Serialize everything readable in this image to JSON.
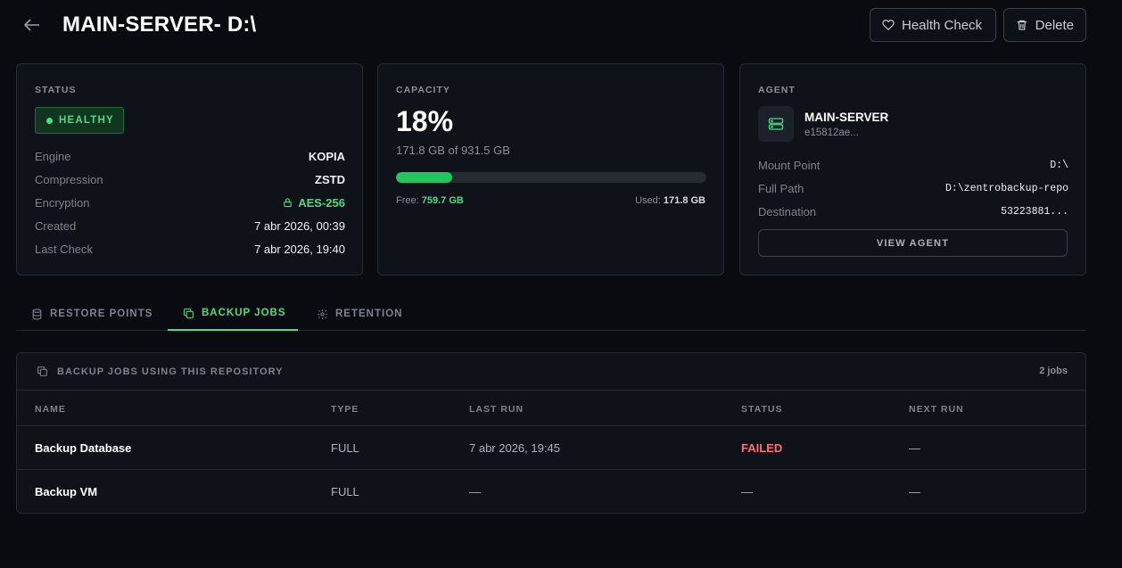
{
  "header": {
    "title": "MAIN-SERVER- D:\\",
    "health_check_label": "Health Check",
    "delete_label": "Delete"
  },
  "status_card": {
    "label": "STATUS",
    "badge": "HEALTHY",
    "rows": [
      {
        "key": "Engine",
        "value": "KOPIA"
      },
      {
        "key": "Compression",
        "value": "ZSTD"
      },
      {
        "key": "Encryption",
        "value": "AES-256"
      },
      {
        "key": "Created",
        "value": "7 abr 2026, 00:39"
      },
      {
        "key": "Last Check",
        "value": "7 abr 2026, 19:40"
      }
    ]
  },
  "capacity_card": {
    "label": "CAPACITY",
    "percent": "18%",
    "used_of_total": "171.8 GB of 931.5 GB",
    "used_fraction": 0.18,
    "free_label": "Free:",
    "free_value": "759.7 GB",
    "used_label": "Used:",
    "used_value": "171.8 GB"
  },
  "agent_card": {
    "label": "AGENT",
    "name": "MAIN-SERVER",
    "id": "e15812ae...",
    "rows": [
      {
        "key": "Mount Point",
        "value": "D:\\"
      },
      {
        "key": "Full Path",
        "value": "D:\\zentrobackup-repo"
      },
      {
        "key": "Destination",
        "value": "53223881..."
      }
    ],
    "view_agent_label": "VIEW AGENT"
  },
  "tabs": [
    {
      "label": "RESTORE POINTS",
      "icon": "database-icon",
      "active": false
    },
    {
      "label": "BACKUP JOBS",
      "icon": "copy-icon",
      "active": true
    },
    {
      "label": "RETENTION",
      "icon": "gear-icon",
      "active": false
    }
  ],
  "jobs": {
    "title": "BACKUP JOBS USING THIS REPOSITORY",
    "count": "2 jobs",
    "columns": [
      "NAME",
      "TYPE",
      "LAST RUN",
      "STATUS",
      "NEXT RUN"
    ],
    "rows": [
      {
        "name": "Backup Database",
        "type": "FULL",
        "last_run": "7 abr 2026, 19:45",
        "status": "FAILED",
        "next_run": "—"
      },
      {
        "name": "Backup VM",
        "type": "FULL",
        "last_run": "—",
        "status": "—",
        "next_run": "—"
      }
    ]
  },
  "colors": {
    "accent": "#4ade80",
    "failed": "#f87171",
    "background": "#090b11",
    "card": "#0f1218"
  }
}
